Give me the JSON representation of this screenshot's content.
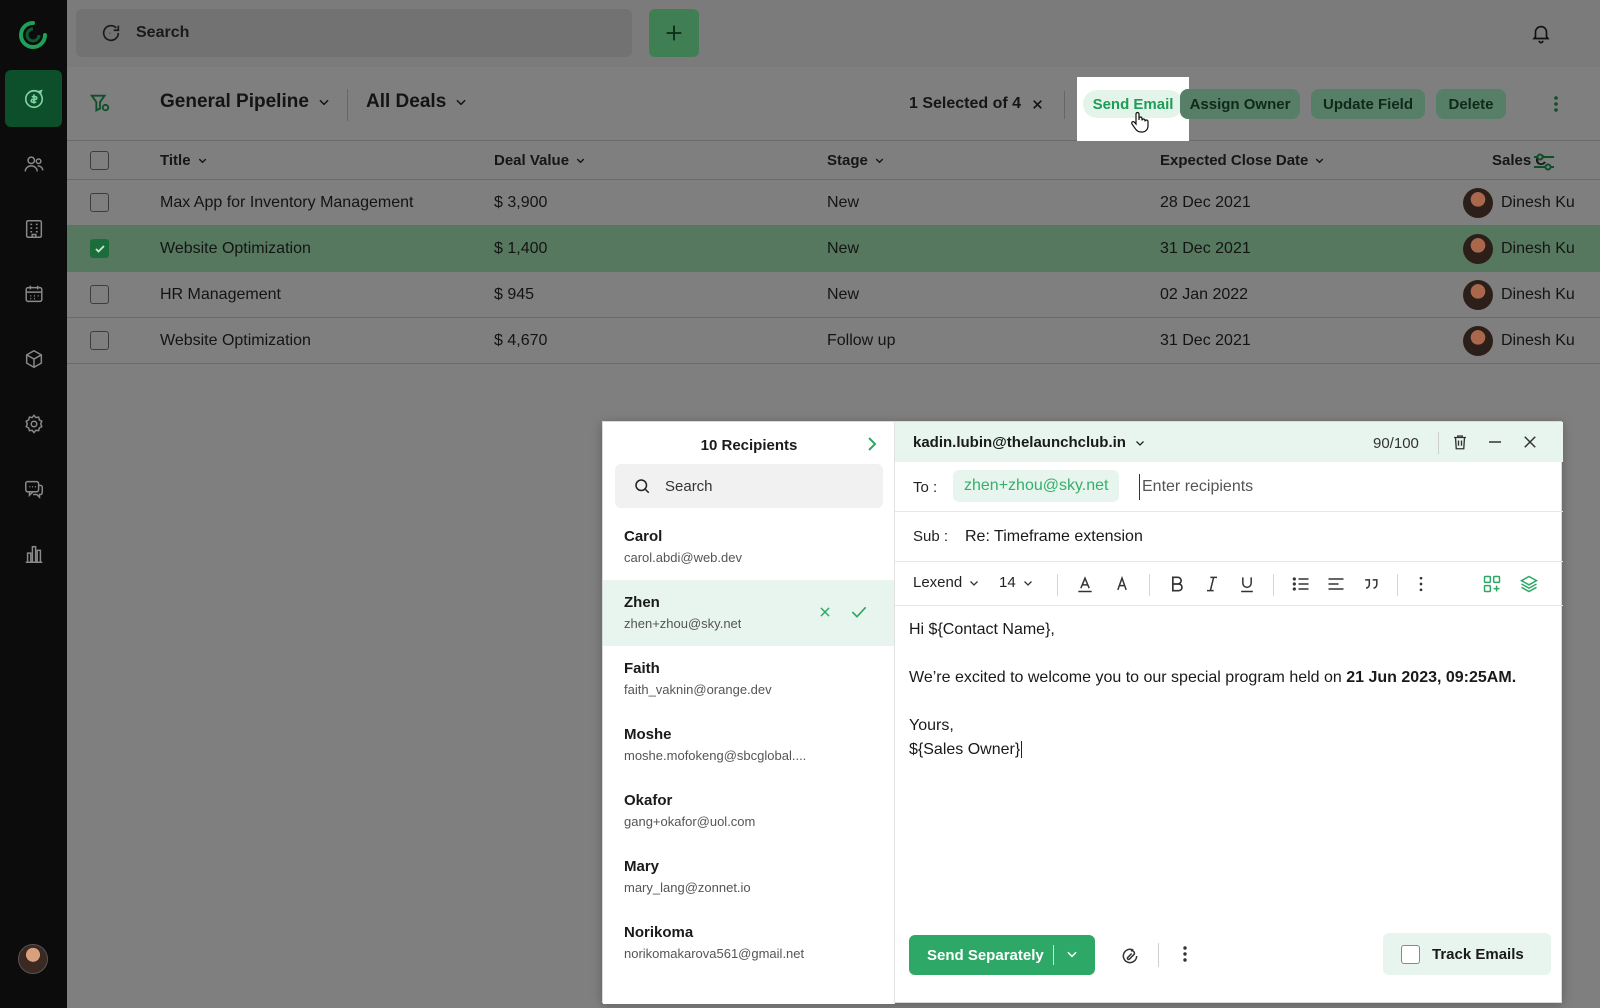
{
  "topbar": {
    "search_placeholder": "Search",
    "add_icon": "plus-icon",
    "notification_icon": "bell-icon"
  },
  "sidebar": {
    "items": [
      {
        "icon": "deals-icon",
        "active": true
      },
      {
        "icon": "contacts-icon"
      },
      {
        "icon": "companies-icon"
      },
      {
        "icon": "calendar-icon"
      },
      {
        "icon": "products-icon"
      },
      {
        "icon": "settings-icon"
      },
      {
        "icon": "chat-icon"
      },
      {
        "icon": "reports-icon"
      }
    ]
  },
  "toolbar": {
    "pipeline": "General Pipeline",
    "view": "All Deals",
    "selected_text": "1 Selected of 4",
    "actions": {
      "send_email": "Send Email",
      "assign_owner": "Assign Owner",
      "update_field": "Update Field",
      "delete": "Delete"
    }
  },
  "table": {
    "columns": [
      "Title",
      "Deal Value",
      "Stage",
      "Expected Close Date",
      "Sales C"
    ],
    "rows": [
      {
        "title": "Max App for Inventory Management",
        "value": "$ 3,900",
        "stage": "New",
        "close": "28 Dec 2021",
        "owner": "Dinesh Ku",
        "selected": false
      },
      {
        "title": "Website Optimization",
        "value": "$ 1,400",
        "stage": "New",
        "close": "31 Dec 2021",
        "owner": "Dinesh Ku",
        "selected": true
      },
      {
        "title": "HR Management",
        "value": "$ 945",
        "stage": "New",
        "close": "02 Jan 2022",
        "owner": "Dinesh Ku",
        "selected": false
      },
      {
        "title": "Website Optimization",
        "value": "$ 4,670",
        "stage": "Follow up",
        "close": "31 Dec 2021",
        "owner": "Dinesh Ku",
        "selected": false
      }
    ]
  },
  "compose": {
    "recipients_title": "10 Recipients",
    "recipients_search_placeholder": "Search",
    "recipients": [
      {
        "name": "Carol",
        "email": "carol.abdi@web.dev"
      },
      {
        "name": "Zhen",
        "email": "zhen+zhou@sky.net",
        "active": true
      },
      {
        "name": "Faith",
        "email": "faith_vaknin@orange.dev"
      },
      {
        "name": "Moshe",
        "email": "moshe.mofokeng@sbcglobal...."
      },
      {
        "name": "Okafor",
        "email": "gang+okafor@uol.com"
      },
      {
        "name": "Mary",
        "email": "mary_lang@zonnet.io"
      },
      {
        "name": "Norikoma",
        "email": "norikomakarova561@gmail.net"
      }
    ],
    "from": "kadin.lubin@thelaunchclub.in",
    "counter": "90/100",
    "to_label": "To :",
    "to_chip": "zhen+zhou@sky.net",
    "to_placeholder": "Enter recipients",
    "sub_label": "Sub :",
    "subject": "Re: Timeframe extension",
    "font": "Lexend",
    "font_size": "14",
    "body": {
      "greeting": "Hi ${Contact Name},",
      "line1_prefix": "We’re excited to welcome you to our special program held on ",
      "line1_date": "21 Jun 2023, 09:25AM.",
      "closing": "Yours,",
      "signature": "${Sales Owner}"
    },
    "send_button": "Send Separately",
    "track_label": "Track Emails"
  },
  "colors": {
    "accent": "#2ea866",
    "accent_light": "#e8f5ee",
    "rail": "#0c0c0c",
    "overlay": "#7f7f7f"
  }
}
